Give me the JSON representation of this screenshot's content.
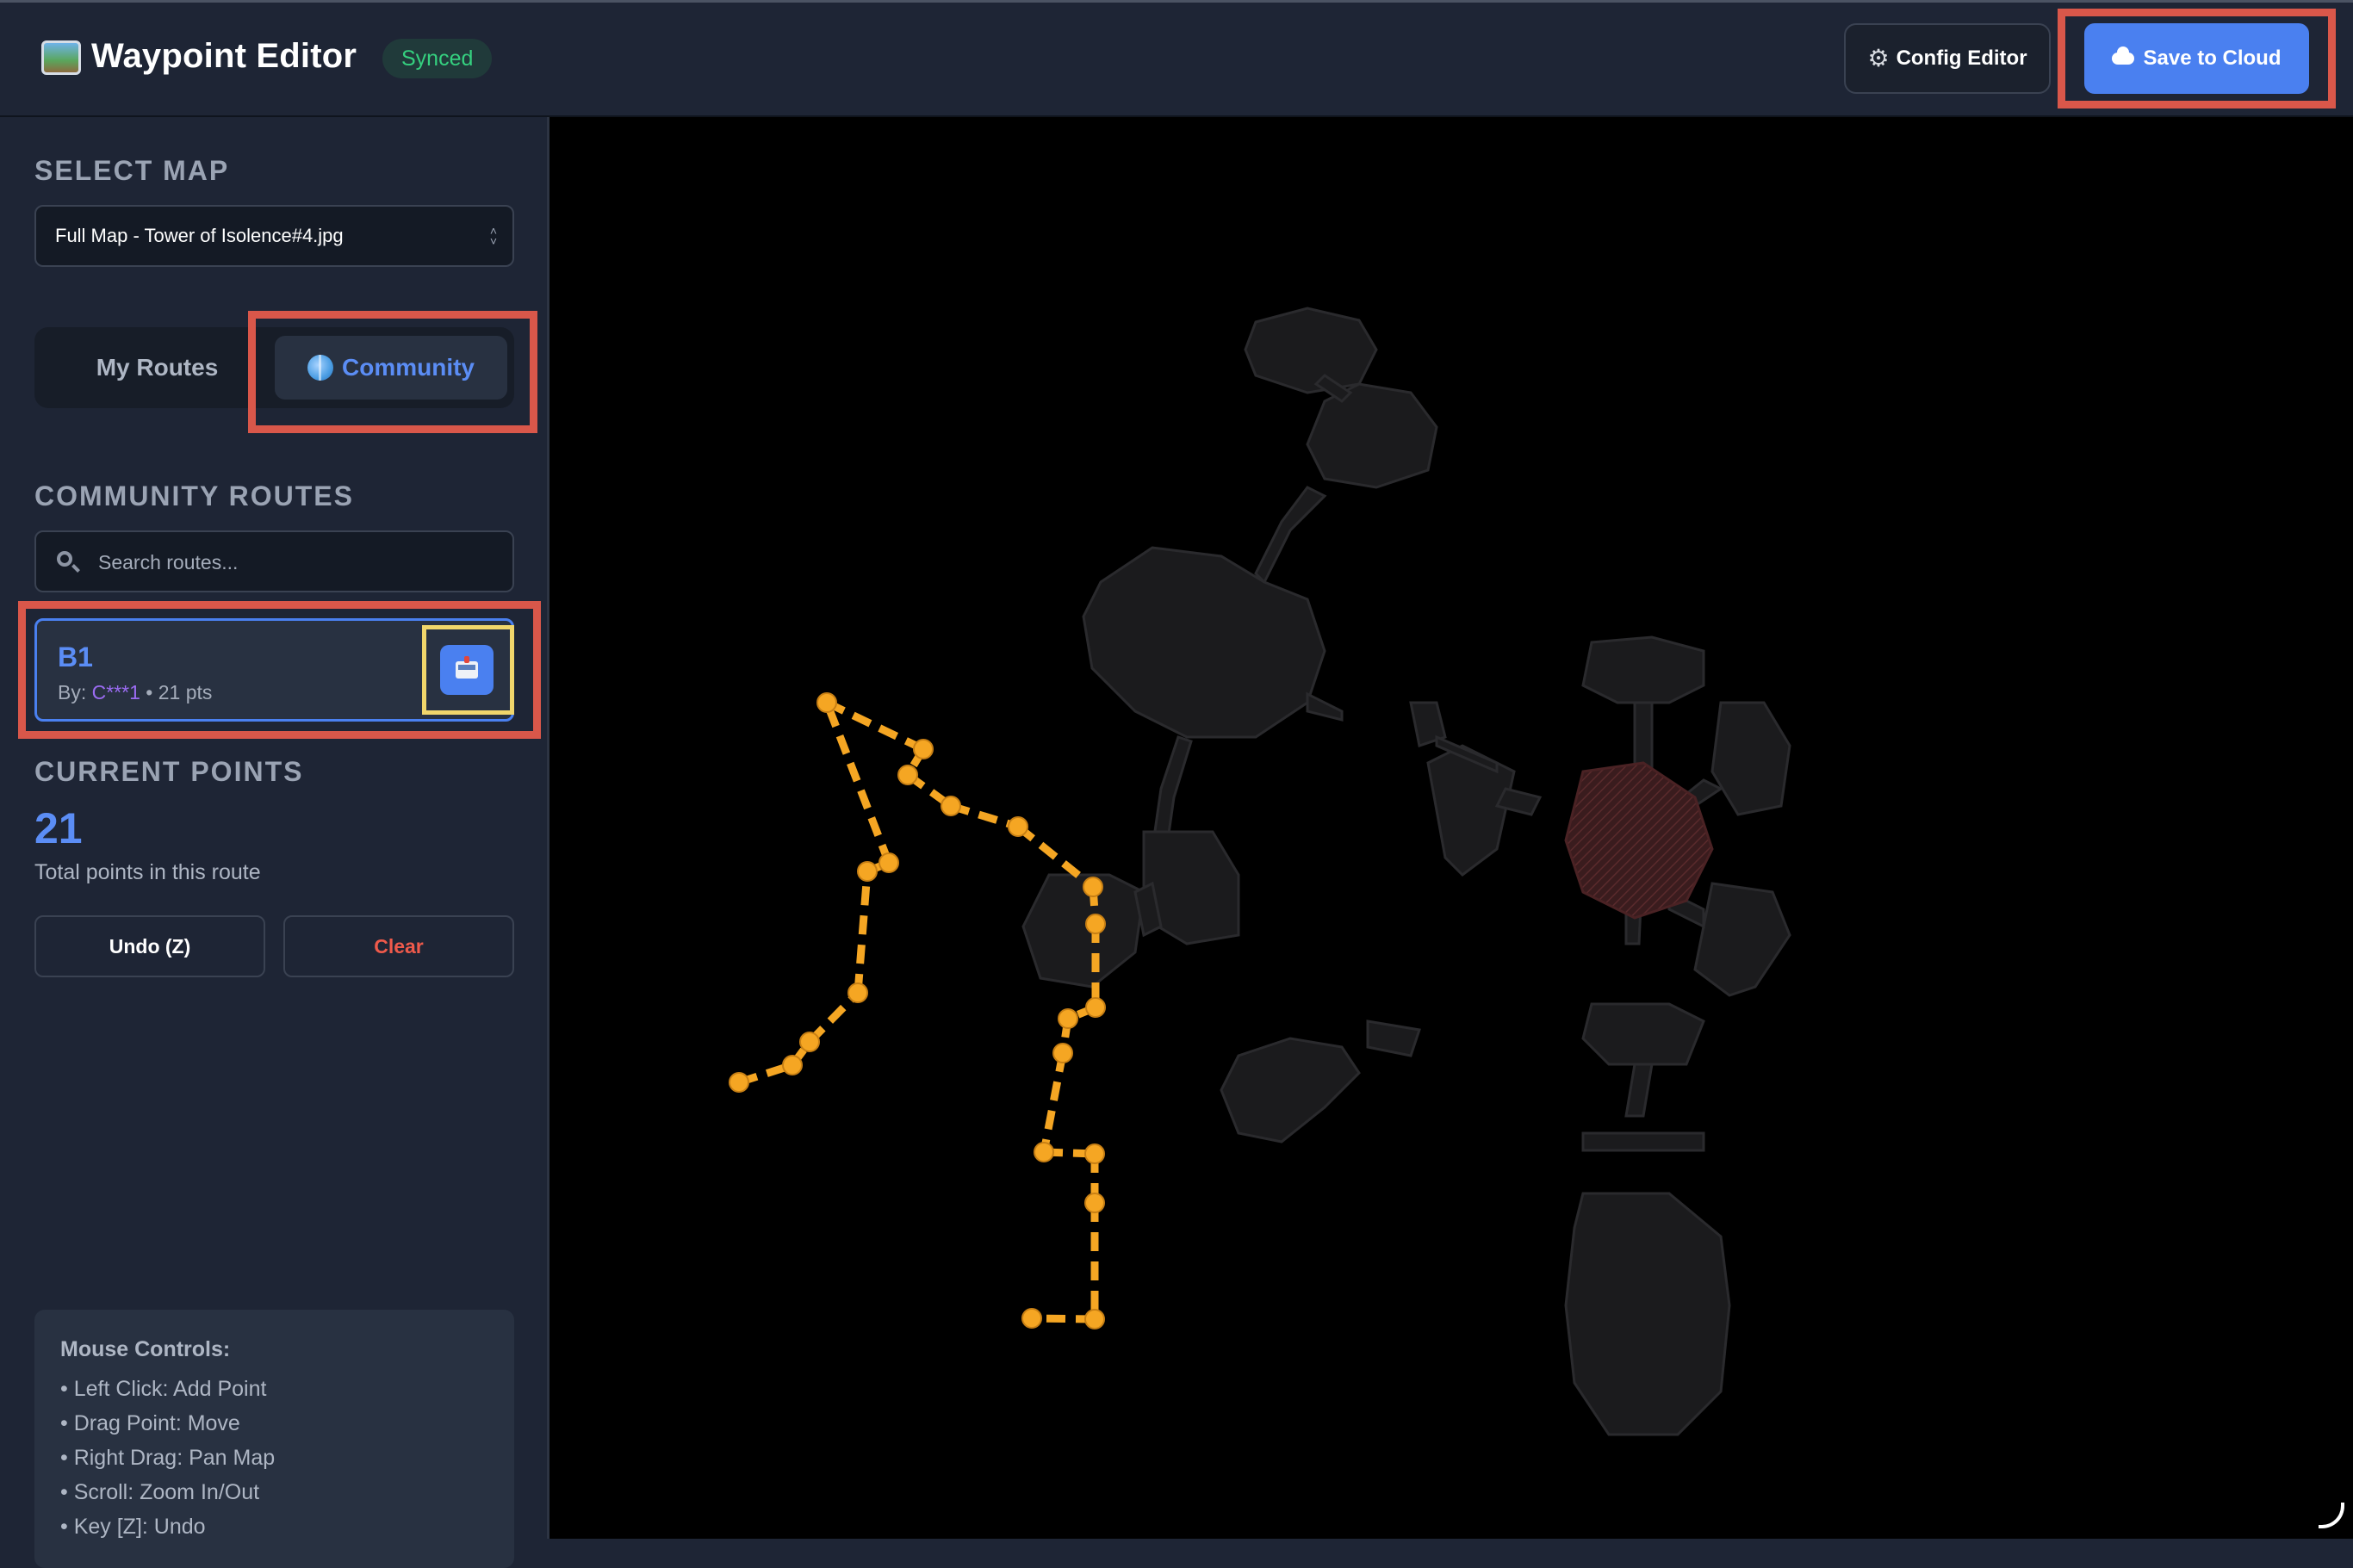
{
  "header": {
    "app_icon": "map-picture-icon",
    "title": "Waypoint Editor",
    "status_badge": "Synced",
    "config_button": {
      "icon": "gear-icon",
      "label": "Config Editor"
    },
    "save_button": {
      "icon": "cloud-icon",
      "label": "Save to Cloud"
    }
  },
  "sidebar": {
    "select_map_label": "SELECT MAP",
    "selected_map": "Full Map - Tower of Isolence#4.jpg",
    "tabs": [
      {
        "label": "My Routes",
        "active": false
      },
      {
        "label": "Community",
        "active": true,
        "icon": "globe-icon"
      }
    ],
    "community_routes_label": "COMMUNITY ROUTES",
    "search_placeholder": "Search routes...",
    "routes": [
      {
        "name": "B1",
        "by_label": "By:",
        "author": "C***1",
        "separator": "•",
        "points": "21 pts",
        "action_icon": "inbox-download-icon"
      }
    ],
    "current_points_label": "CURRENT POINTS",
    "current_points_value": "21",
    "current_points_desc": "Total points in this route",
    "undo_label": "Undo (Z)",
    "clear_label": "Clear",
    "help": {
      "title": "Mouse Controls:",
      "items": [
        "• Left Click: Add Point",
        "• Drag Point: Move",
        "• Right Drag: Pan Map",
        "• Scroll: Zoom In/Out",
        "• Key [Z]: Undo"
      ]
    }
  },
  "colors": {
    "accent": "#4a80f0",
    "route_line": "#f5a623",
    "danger": "#ef5a4b",
    "success": "#35d07f",
    "highlight_red": "#d9574a",
    "highlight_yellow": "#f1d66b"
  }
}
